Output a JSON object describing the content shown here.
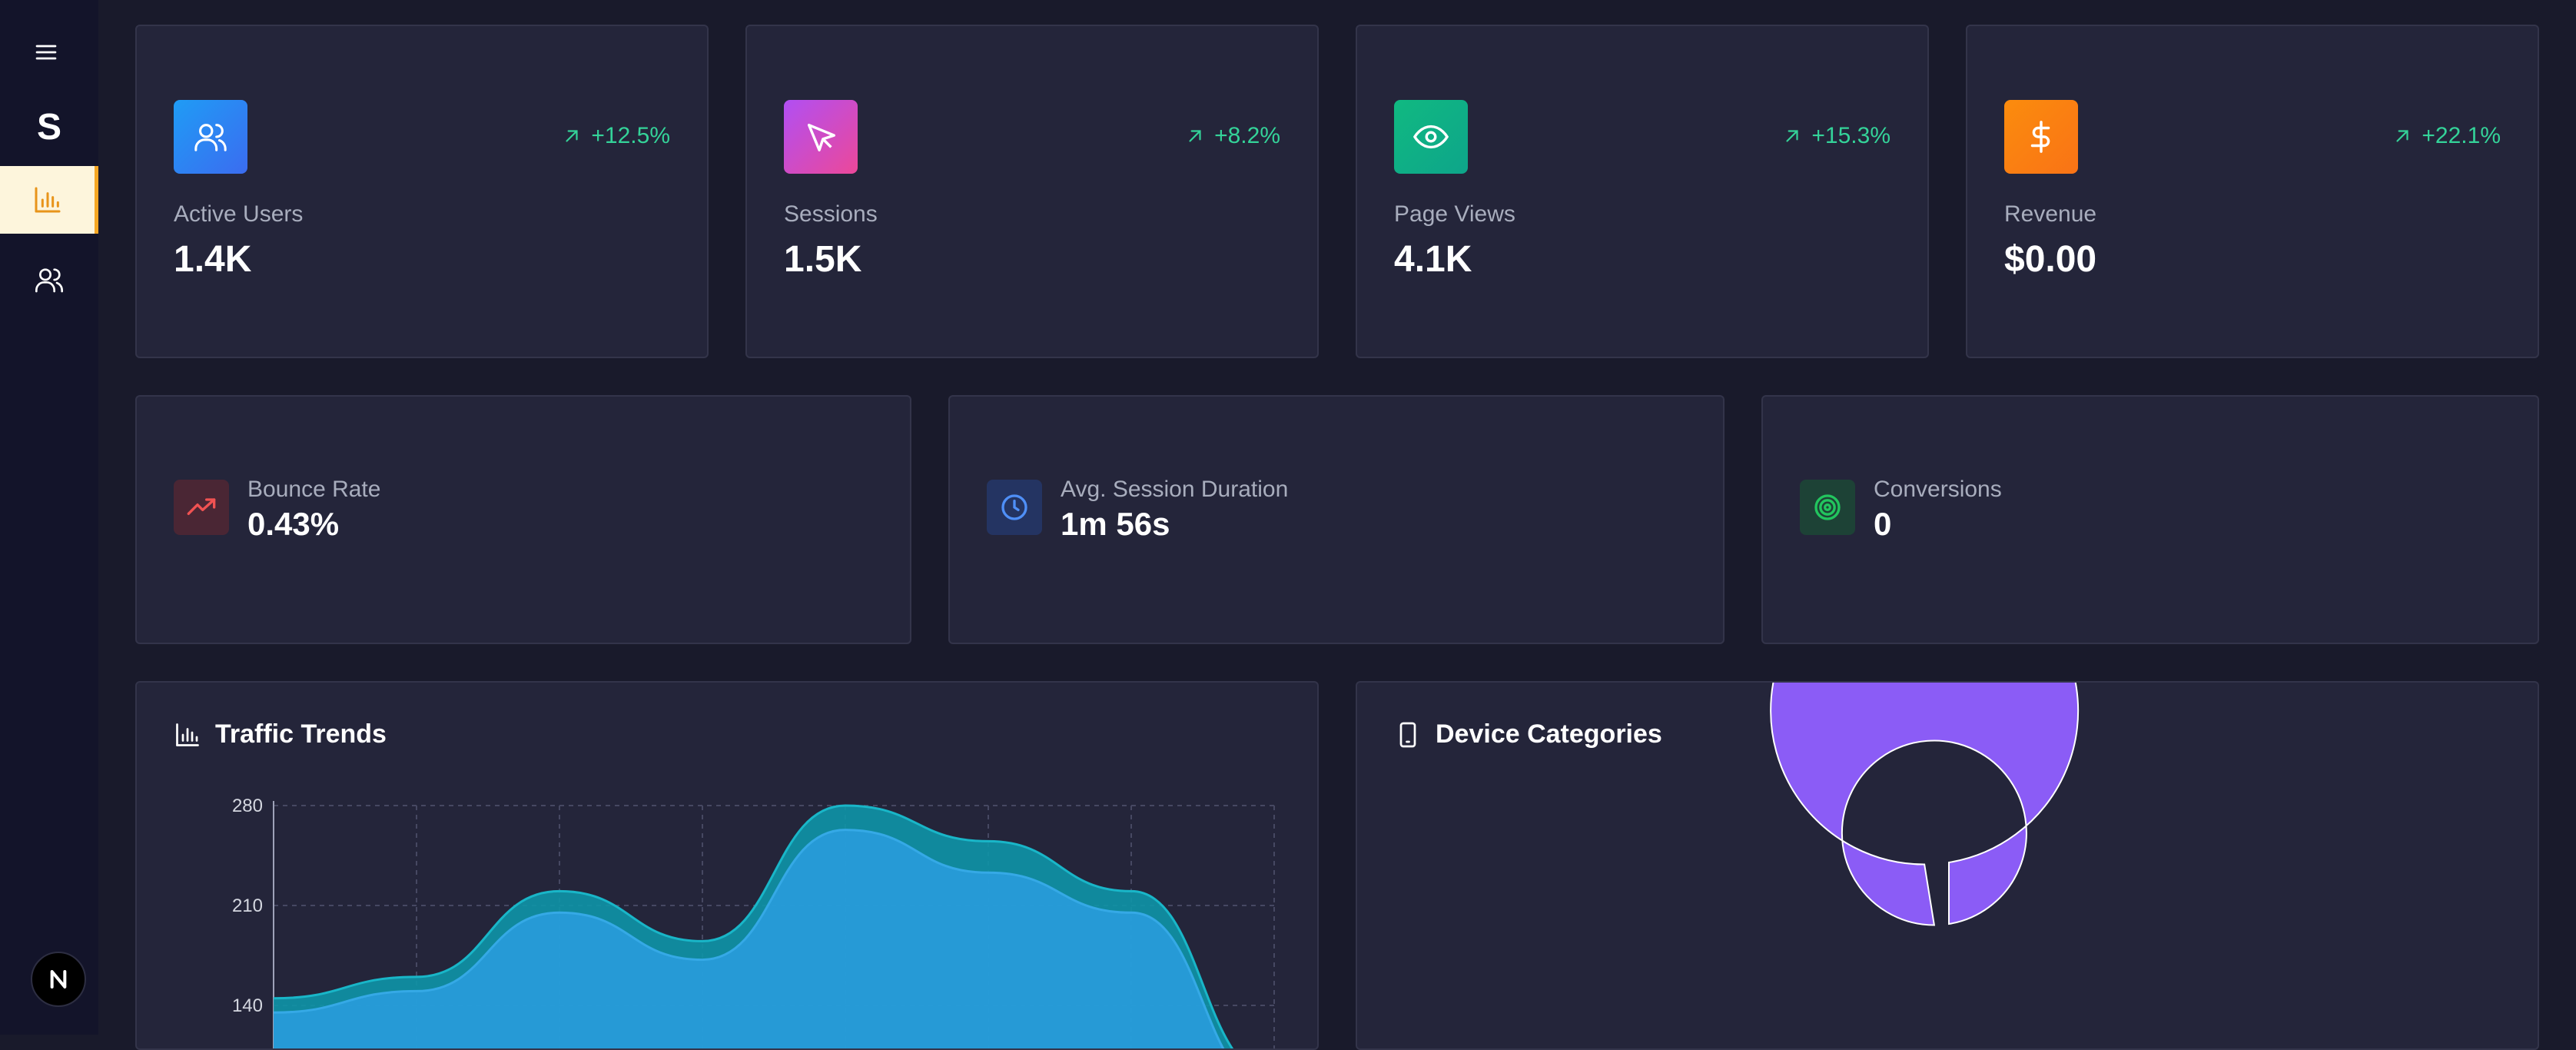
{
  "sidebar": {
    "logo": "S",
    "items": [
      {
        "icon": "bar-chart-icon",
        "active": true
      },
      {
        "icon": "users-icon",
        "active": false
      }
    ],
    "avatar_letter": "N"
  },
  "stats": [
    {
      "label": "Active Users",
      "value": "1.4K",
      "change": "+12.5%",
      "icon": "users-icon",
      "color": "#2f8ef5"
    },
    {
      "label": "Sessions",
      "value": "1.5K",
      "change": "+8.2%",
      "icon": "cursor-icon",
      "color": "#c64ff0"
    },
    {
      "label": "Page Views",
      "value": "4.1K",
      "change": "+15.3%",
      "icon": "eye-icon",
      "color": "#10b981"
    },
    {
      "label": "Revenue",
      "value": "$0.00",
      "change": "+22.1%",
      "icon": "dollar-icon",
      "color": "#f97316"
    }
  ],
  "metrics": [
    {
      "label": "Bounce Rate",
      "value": "0.43%",
      "icon": "trending-up-icon",
      "color": "#ef4444"
    },
    {
      "label": "Avg. Session Duration",
      "value": "1m 56s",
      "icon": "clock-icon",
      "color": "#3b82f6"
    },
    {
      "label": "Conversions",
      "value": "0",
      "icon": "target-icon",
      "color": "#22c55e"
    }
  ],
  "traffic_panel": {
    "title": "Traffic Trends"
  },
  "device_panel": {
    "title": "Device Categories"
  },
  "chart_data": [
    {
      "type": "area",
      "title": "Traffic Trends",
      "xlabel": "",
      "ylabel": "",
      "ylim": [
        0,
        280
      ],
      "yticks": [
        140,
        210,
        280
      ],
      "grid": true,
      "x": [
        0,
        1,
        2,
        3,
        4,
        5,
        6,
        7
      ],
      "series": [
        {
          "values": [
            145,
            160,
            220,
            185,
            280,
            255,
            220,
            90
          ],
          "color": "#0e95a8"
        },
        {
          "values": [
            135,
            150,
            205,
            172,
            263,
            233,
            205,
            80
          ],
          "color": "#2a9ee0"
        }
      ]
    },
    {
      "type": "pie",
      "title": "Device Categories",
      "slices": [
        {
          "value": 1,
          "color": "#8b5cf6"
        }
      ]
    }
  ]
}
